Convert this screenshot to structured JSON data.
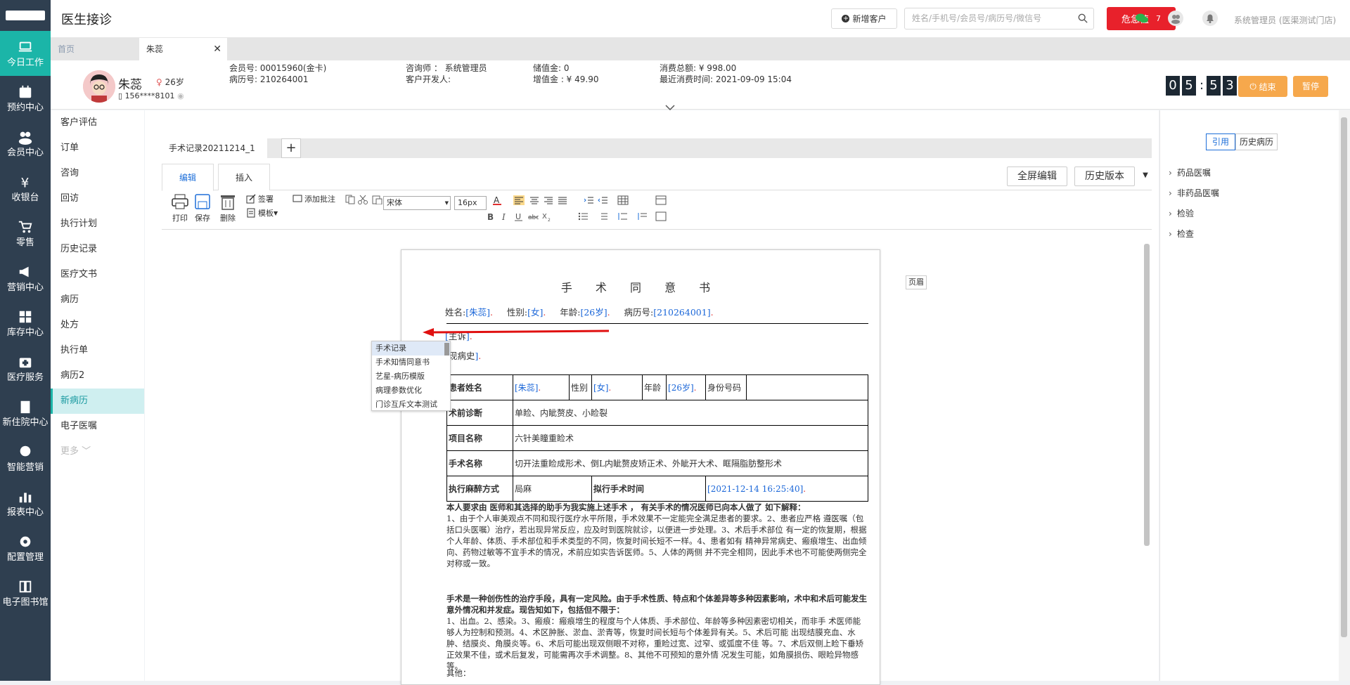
{
  "leftnav": {
    "items": [
      {
        "label": "今日工作",
        "icon": "laptop-icon"
      },
      {
        "label": "预约中心",
        "icon": "calendar-icon"
      },
      {
        "label": "会员中心",
        "icon": "users-icon"
      },
      {
        "label": "收银台",
        "icon": "yen-icon"
      },
      {
        "label": "零售",
        "icon": "cart-icon"
      },
      {
        "label": "营销中心",
        "icon": "megaphone-icon"
      },
      {
        "label": "库存中心",
        "icon": "grid-icon"
      },
      {
        "label": "医疗服务",
        "icon": "medkit-icon"
      },
      {
        "label": "新住院中心",
        "icon": "building-icon"
      },
      {
        "label": "智能营销",
        "icon": "brain-icon"
      },
      {
        "label": "报表中心",
        "icon": "bar-chart-icon"
      },
      {
        "label": "配置管理",
        "icon": "gear-icon"
      },
      {
        "label": "电子图书馆",
        "icon": "book-icon"
      }
    ]
  },
  "header": {
    "title": "医生接诊",
    "new_customer": "新增客户",
    "search_placeholder": "姓名/手机号/会员号/病历号/微信号",
    "critical_label": "危急值",
    "critical_count": "7",
    "user": "系统管理员 (医渠测试门店)"
  },
  "tabs": {
    "home": "首页",
    "current": "朱蕊"
  },
  "patient": {
    "name": "朱蕊",
    "age": "26岁",
    "phone": "156****8101",
    "member_no": "会员号:  00015960(金卡)",
    "record_no": "病历号:  210264001",
    "consultant": "咨询师   ：  系统管理员",
    "developer": "客户开发人:",
    "stored": "储值金:  0",
    "bonus": "增值金  :  ¥ 49.90",
    "total_spend": "消费总额:  ¥ 998.00",
    "last_spend": "最近消费时间:  2021-09-09 15:04",
    "timer": [
      "0",
      "5",
      ":",
      "5",
      "3"
    ],
    "end": "结束",
    "pause": "暂停"
  },
  "subnav": {
    "items": [
      "客户评估",
      "订单",
      "咨询",
      "回访",
      "执行计划",
      "历史记录",
      "医疗文书",
      "病历",
      "处方",
      "执行单",
      "病历2",
      "新病历",
      "电子医嘱"
    ],
    "active": "新病历",
    "more": "更多"
  },
  "editor": {
    "doc_tab": "手术记录20211214_1",
    "ribbon_tabs": [
      "编辑",
      "插入"
    ],
    "fullscreen": "全屏编辑",
    "history": "历史版本",
    "tools": {
      "print": "打印",
      "save": "保存",
      "delete": "删除",
      "sign": "签署",
      "template": "模板",
      "annotate": "添加批注"
    },
    "font": "宋体",
    "size": "16px",
    "template_options": [
      "手术记录",
      "手术知情同意书",
      "艺星-病历模版",
      "病理参数优化",
      "门诊互斥文本测试"
    ],
    "page_label": "页眉"
  },
  "document": {
    "title": "手 术 同 意 书",
    "line1": {
      "name_label": "姓名:",
      "name": "朱蕊",
      "sex_label": "性别:",
      "sex": "女",
      "age_label": "年龄:",
      "age": "26岁",
      "rec_label": "病历号:",
      "rec": "210264001"
    },
    "complaint": "主诉",
    "history": "现病史",
    "table": {
      "patient_name_label": "患者姓名",
      "patient_name": "朱蕊",
      "sex_label": "性别",
      "sex": "女",
      "age_label": "年龄",
      "age": "26岁",
      "id_label": "身份号码",
      "pre_dx_label": "术前诊断",
      "pre_dx": "单睑、内眦赘皮、小睑裂",
      "project_label": "项目名称",
      "project": "六针美瞳重睑术",
      "surgery_label": "手术名称",
      "surgery": "切开法重睑成形术、倒L内眦赘皮矫正术、外眦开大术、眶隔脂肪整形术",
      "anes_label": "执行麻醉方式",
      "anes": "局麻",
      "time_label": "拟行手术时间",
      "time": "2021-12-14 16:25:40"
    },
    "para1_head": "本人要求由  医师和其选择的助手为我实施上述手术  ，  有关手术的情况医师已向本人做了  如下解释：",
    "para1_body": "1、由于个人审美观点不同和现行医疗水平所限，手术效果不一定能完全满足患者的要求。2、患者应严格  遵医嘱（包括口头医嘱）治疗，若出现异常反应，应及时到医院就诊，以便进一步处理。3、术后手术部位  有一定的恢复期，根据个人年龄、体质、手术部位和手术类型的不同，恢复时间长短不一样。4、患者如有  精神异常病史、瘢痕增生、出血倾向、药物过敏等不宜手术的情况，术前应如实告诉医师。5、人体的两侧  并不完全相同，因此手术也不可能使两侧完全对称或一致。",
    "para2_head": "手术是一种创伤性的治疗手段，具有一定风险。由于手术性质、特点和个体差异等多种因素影响，术中和术后可能发生意外情况和并发症。现告知如下，包括但不限于：",
    "para2_body": "1、出血。2、感染。3、瘢痕：瘢痕增生的程度与个人体质、手术部位、年龄等多种因素密切相关，而非手  术医师能够人为控制和预测。4、术区肿胀、淤血、淤青等，恢复时间长短与个体差异有关。5、术后可能  出现结膜充血、水肿、结膜炎、角膜炎等。6、术后可能出现双侧眼不对称，重睑过宽、过窄、或弧度不佳  等。7、术后双侧上睑下垂矫正效果不佳，或术后复发，可能需再次手术调整。8、其他不可预知的意外情  况发生可能，如角膜损伤、眼睑异物感等。",
    "other": "其他："
  },
  "right_panel": {
    "seg": [
      "引用",
      "历史病历"
    ],
    "items": [
      "药品医嘱",
      "非药品医嘱",
      "检验",
      "检查"
    ]
  }
}
